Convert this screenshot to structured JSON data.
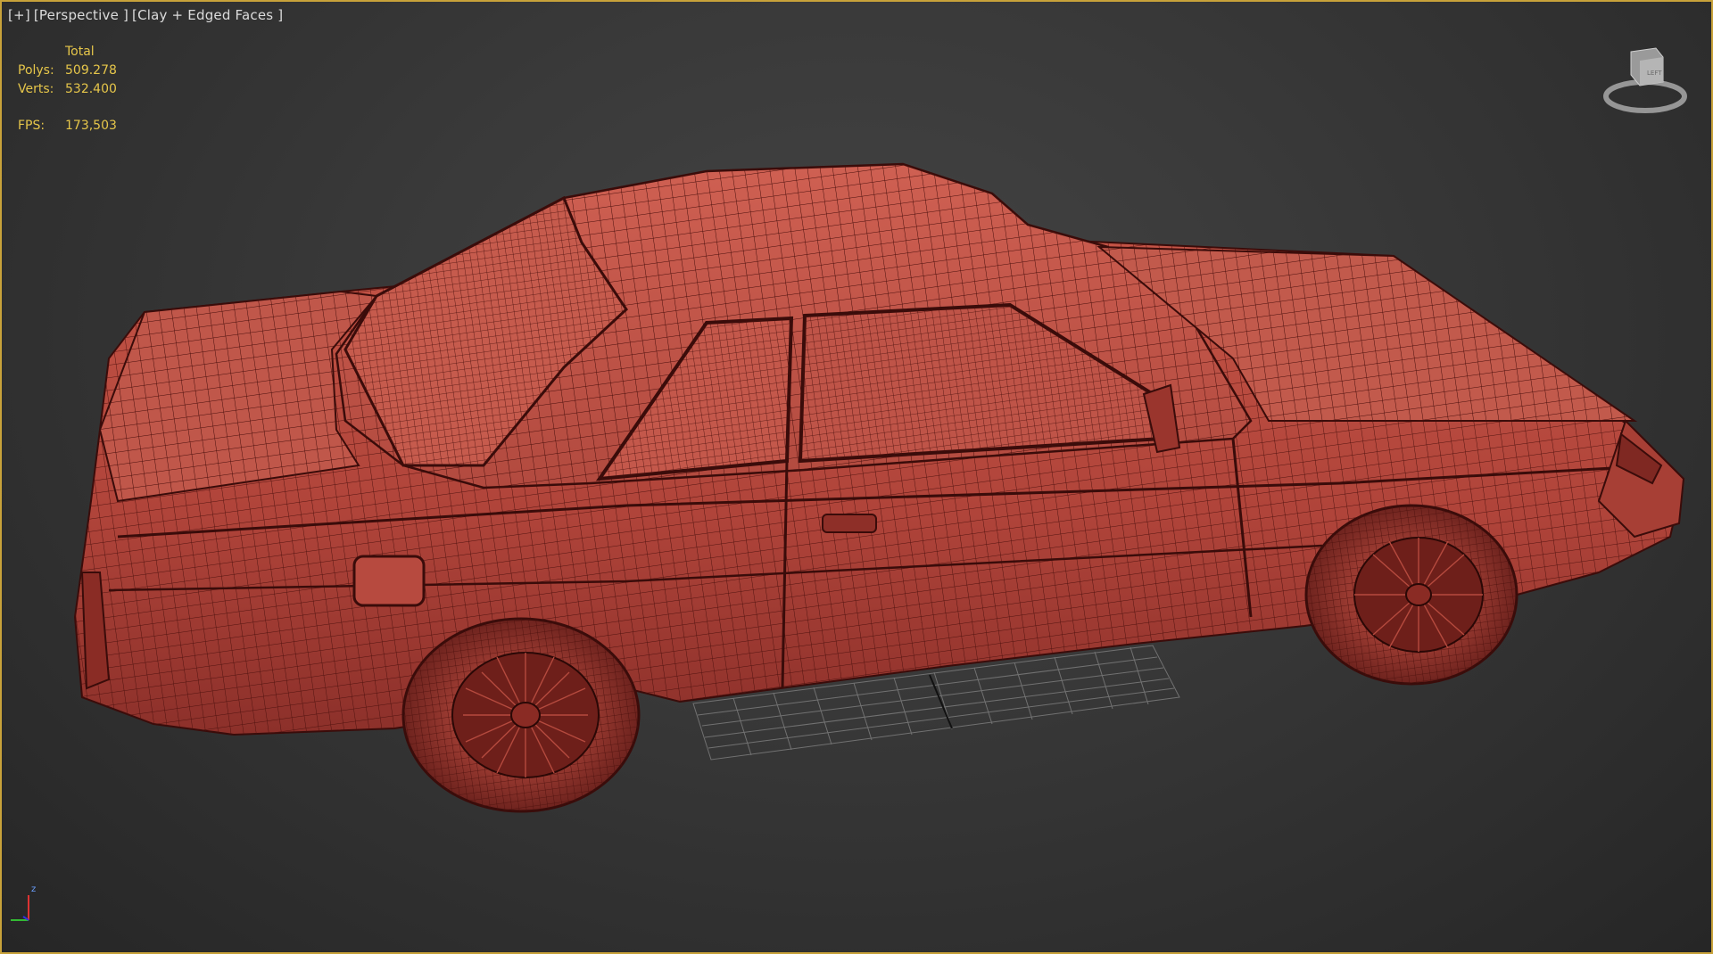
{
  "viewport": {
    "plus_label": "[+]",
    "view_label": "[Perspective ]",
    "shading_label": "[Clay + Edged Faces ]"
  },
  "stats": {
    "header": "Total",
    "polys_label": "Polys:",
    "polys_value": "509.278",
    "verts_label": "Verts:",
    "verts_value": "532.400",
    "fps_label": "FPS:",
    "fps_value": "173,503"
  },
  "viewcube": {
    "face_label": "LEFT"
  },
  "axis": {
    "z_label": "z"
  },
  "colors": {
    "frame": "#c8a23a",
    "stats_text": "#e6c64a",
    "clay": "#b6483d",
    "wire": "#4a0f0c",
    "grid": "#8a8a8a"
  }
}
